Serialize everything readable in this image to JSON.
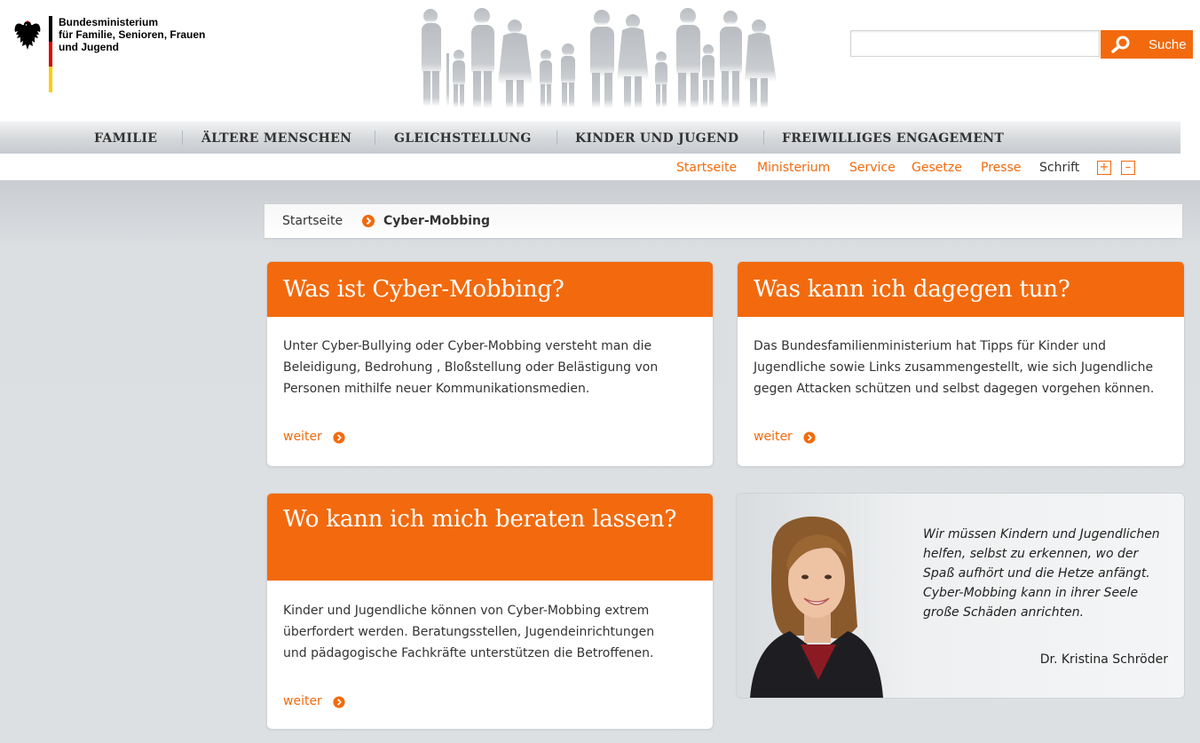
{
  "header": {
    "logo_lines": [
      "Bundesministerium",
      "für Familie, Senioren, Frauen",
      "und Jugend"
    ],
    "flag_colors": [
      "#000000",
      "#dd0000",
      "#ffcc00"
    ],
    "banner_icon": "family-silhouette"
  },
  "search": {
    "placeholder": "",
    "value": "",
    "button_label": "Suche",
    "icon": "search-icon"
  },
  "main_nav": [
    "FAMILIE",
    "ÄLTERE MENSCHEN",
    "GLEICHSTELLUNG",
    "KINDER UND JUGEND",
    "FREIWILLIGES ENGAGEMENT"
  ],
  "service_nav": {
    "links": [
      "Startseite",
      "Ministerium",
      "Service",
      "Gesetze",
      "Presse"
    ],
    "font_label": "Schrift",
    "font_increase": "+",
    "font_decrease": "–"
  },
  "breadcrumb": {
    "home": "Startseite",
    "current": "Cyber-Mobbing"
  },
  "cards": [
    {
      "title": "Was ist Cyber-Mobbing?",
      "body": "Unter Cyber-Bullying oder Cyber-Mobbing versteht man die Beleidigung, Bedrohung , Bloßstellung oder Belästigung von Personen mithilfe neuer Kommunikationsmedien.",
      "link": "weiter"
    },
    {
      "title": "Was kann ich dagegen tun?",
      "body": "Das Bundesfamilienministerium hat Tipps für Kinder und Jugendliche sowie Links zusammengestellt, wie sich Jugendliche gegen Attacken schützen und selbst dagegen vorgehen können.",
      "link": "weiter"
    },
    {
      "title": "Wo kann ich mich beraten lassen?",
      "body": "Kinder und Jugendliche können von Cyber-Mobbing extrem überfordert werden. Beratungsstellen, Jugendeinrichtungen und pädagogische Fachkräfte unterstützen die Betroffenen.",
      "link": "weiter"
    }
  ],
  "quote": {
    "text": "Wir müssen Kindern und Jugendlichen helfen, selbst zu erkennen, wo der Spaß aufhört und die Hetze anfängt. Cyber-Mobbing kann in ihrer Seele große Schäden anrichten.",
    "author": "Dr. Kristina Schröder"
  },
  "colors": {
    "accent": "#f26a0d",
    "nav_bg": "#d5d8db",
    "content_bg": "#dde0e3"
  }
}
